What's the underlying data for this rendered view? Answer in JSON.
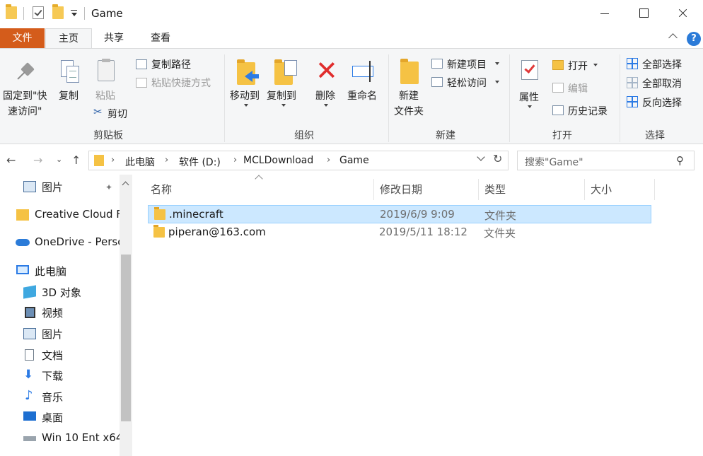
{
  "window": {
    "title": "Game"
  },
  "tabs": {
    "file": "文件",
    "home": "主页",
    "share": "共享",
    "view": "查看"
  },
  "ribbon": {
    "clipboard": {
      "group_label": "剪贴板",
      "pin_line1": "固定到\"快",
      "pin_line2": "速访问\"",
      "copy": "复制",
      "paste": "粘贴",
      "copy_path": "复制路径",
      "paste_shortcut": "粘贴快捷方式",
      "cut": "剪切"
    },
    "organize": {
      "group_label": "组织",
      "move_to": "移动到",
      "copy_to": "复制到",
      "delete": "删除",
      "rename": "重命名"
    },
    "new": {
      "group_label": "新建",
      "new_folder_line1": "新建",
      "new_folder_line2": "文件夹",
      "new_item": "新建项目",
      "easy_access": "轻松访问"
    },
    "open": {
      "group_label": "打开",
      "properties": "属性",
      "open": "打开",
      "edit": "编辑",
      "history": "历史记录"
    },
    "select": {
      "group_label": "选择",
      "select_all": "全部选择",
      "select_none": "全部取消",
      "invert": "反向选择"
    }
  },
  "address": {
    "crumbs": [
      "此电脑",
      "软件 (D:)",
      "MCLDownload",
      "Game"
    ],
    "search_placeholder": "搜索\"Game\""
  },
  "nav": {
    "items": [
      {
        "label": "图片",
        "icon": "pictures-icon"
      },
      {
        "label": "Creative Cloud F",
        "icon": "creative-cloud-icon"
      },
      {
        "label": "OneDrive - Perso",
        "icon": "onedrive-icon"
      },
      {
        "label": "此电脑",
        "icon": "this-pc-icon"
      },
      {
        "label": "3D 对象",
        "icon": "3d-objects-icon"
      },
      {
        "label": "视频",
        "icon": "videos-icon"
      },
      {
        "label": "图片",
        "icon": "pictures-icon"
      },
      {
        "label": "文档",
        "icon": "documents-icon"
      },
      {
        "label": "下载",
        "icon": "downloads-icon"
      },
      {
        "label": "音乐",
        "icon": "music-icon"
      },
      {
        "label": "桌面",
        "icon": "desktop-icon"
      },
      {
        "label": "Win 10 Ent x64",
        "icon": "drive-icon"
      }
    ]
  },
  "filelist": {
    "columns": [
      "名称",
      "修改日期",
      "类型",
      "大小"
    ],
    "rows": [
      {
        "name": ".minecraft",
        "date": "2019/6/9 9:09",
        "type": "文件夹",
        "size": ""
      },
      {
        "name": "piperan@163.com",
        "date": "2019/5/11 18:12",
        "type": "文件夹",
        "size": ""
      }
    ]
  },
  "colors": {
    "file_tab": "#d45c1b",
    "selection": "#cce8ff",
    "accent": "#2c7be5"
  }
}
